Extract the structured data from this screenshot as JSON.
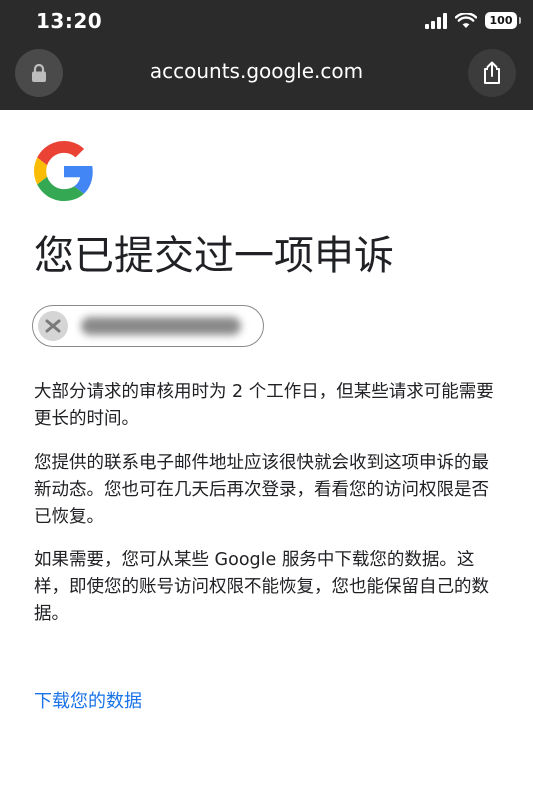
{
  "status_bar": {
    "time": "13:20",
    "battery_level": "100"
  },
  "browser": {
    "url": "accounts.google.com"
  },
  "page": {
    "title": "您已提交过一项申诉",
    "paragraphs": [
      "大部分请求的审核用时为 2 个工作日，但某些请求可能需要更长的时间。",
      "您提供的联系电子邮件地址应该很快就会收到这项申诉的最新动态。您也可在几天后再次登录，看看您的访问权限是否已恢复。",
      "如果需要，您可从某些 Google 服务中下载您的数据。这样，即使您的账号访问权限不能恢复，您也能保留自己的数据。"
    ],
    "download_link": "下载您的数据"
  },
  "colors": {
    "toolbar_bg": "#2b2b2b",
    "link": "#1a73e8",
    "text": "#202124",
    "google_blue": "#4285F4",
    "google_red": "#EA4335",
    "google_yellow": "#FBBC05",
    "google_green": "#34A853"
  },
  "icons": [
    "signal-icon",
    "wifi-icon",
    "battery-icon",
    "lock-icon",
    "share-icon",
    "google-logo",
    "avatar-icon"
  ]
}
